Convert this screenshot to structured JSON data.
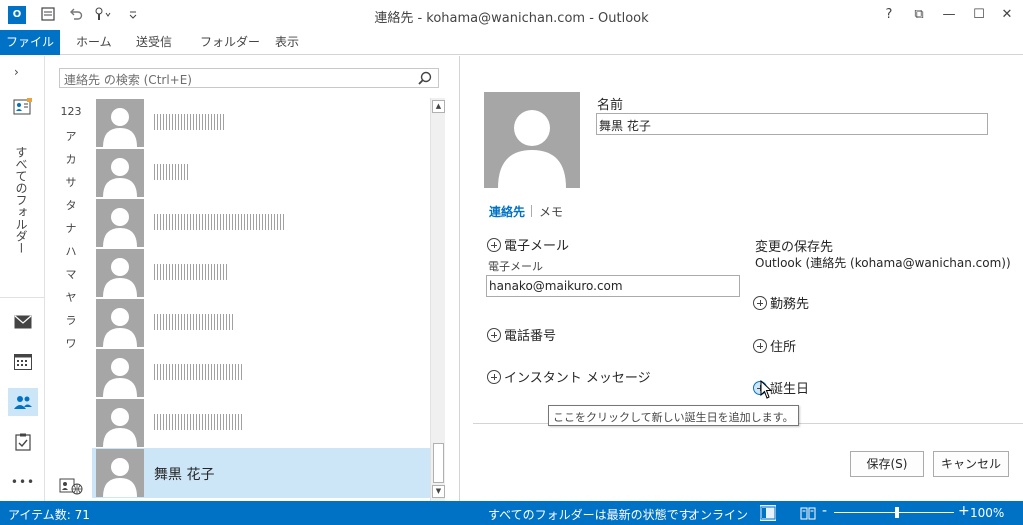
{
  "window": {
    "title": "連絡先 - kohama@wanichan.com - Outlook",
    "app_icon_text": "O",
    "controls": {
      "help": "?",
      "restore_ribbon": "⧉",
      "minimize": "—",
      "maximize": "☐",
      "close": "✕"
    }
  },
  "ribbon": {
    "tabs": [
      "ファイル",
      "ホーム",
      "送受信",
      "フォルダー",
      "表示"
    ]
  },
  "nav": {
    "expand": "›",
    "folder_label": "すべてのフォルダー",
    "more": "•••"
  },
  "search": {
    "placeholder": "連絡先 の検索 (Ctrl+E)"
  },
  "alpha_index": [
    "123",
    "ア",
    "カ",
    "サ",
    "タ",
    "ナ",
    "ハ",
    "マ",
    "ヤ",
    "ラ",
    "ワ"
  ],
  "contacts": [
    {
      "name": "",
      "blurred": true
    },
    {
      "name": "",
      "blurred": true
    },
    {
      "name": "",
      "blurred": true
    },
    {
      "name": "",
      "blurred": true
    },
    {
      "name": "",
      "blurred": true
    },
    {
      "name": "",
      "blurred": true
    },
    {
      "name": "",
      "blurred": true
    },
    {
      "name": "舞黒 花子",
      "blurred": false,
      "selected": true
    }
  ],
  "detail": {
    "name_label": "名前",
    "name_value": "舞黒 花子",
    "tabs": {
      "contact": "連絡先",
      "memo": "メモ"
    },
    "email_section": "電子メール",
    "email_label": "電子メール",
    "email_value": "hanako@maikuro.com",
    "phone_section": "電話番号",
    "im_section": "インスタント メッセージ",
    "save_to_label": "変更の保存先",
    "save_to_value": "Outlook (連絡先 (kohama@wanichan.com))",
    "work_section": "勤務先",
    "address_section": "住所",
    "birthday_section": "誕生日",
    "tooltip": "ここをクリックして新しい誕生日を追加します。",
    "save_button": "保存(S)",
    "cancel_button": "キャンセル"
  },
  "status": {
    "items": "アイテム数: 71",
    "sync": "すべてのフォルダーは最新の状態です。",
    "online": "オンライン",
    "zoom": "100%",
    "zoom_minus": "-",
    "zoom_plus": "+"
  },
  "colors": {
    "accent": "#0072c6",
    "selection": "#cde6f7",
    "avatar_bg": "#a6a6a6"
  }
}
